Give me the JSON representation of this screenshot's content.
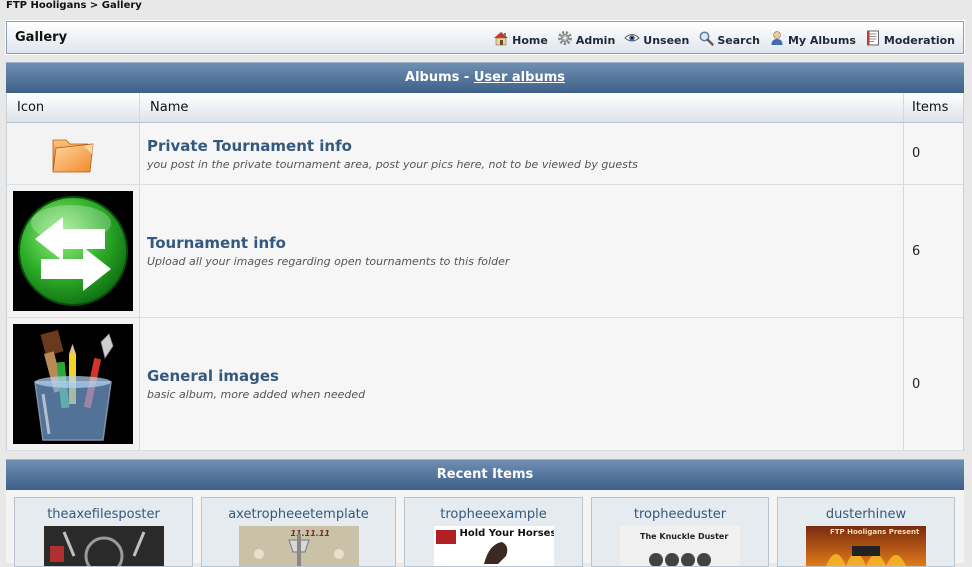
{
  "breadcrumb": {
    "root": "FTP Hooligans",
    "sep": ">",
    "current": "Gallery"
  },
  "topbar": {
    "title": "Gallery",
    "nav": [
      {
        "label": "Home",
        "icon": "home-icon"
      },
      {
        "label": "Admin",
        "icon": "gear-icon"
      },
      {
        "label": "Unseen",
        "icon": "eye-icon"
      },
      {
        "label": "Search",
        "icon": "search-icon"
      },
      {
        "label": "My Albums",
        "icon": "user-icon"
      },
      {
        "label": "Moderation",
        "icon": "document-icon"
      }
    ]
  },
  "albums": {
    "header": "Albums",
    "header_sep": "-",
    "header_link": "User albums",
    "columns": {
      "icon": "Icon",
      "name": "Name",
      "items": "Items"
    },
    "rows": [
      {
        "title": "Private Tournament info",
        "desc": "you post in the private tournament area, post your pics here, not to be viewed by guests",
        "items": "0",
        "icon": "folder-icon"
      },
      {
        "title": "Tournament info",
        "desc": "Upload all your images regarding open tournaments to this folder",
        "items": "6",
        "icon": "exchange-arrows-icon"
      },
      {
        "title": "General images",
        "desc": "basic album, more added when needed",
        "items": "0",
        "icon": "pencil-cup-icon"
      }
    ]
  },
  "recent": {
    "header": "Recent Items",
    "items": [
      {
        "name": "theaxefilesposter"
      },
      {
        "name": "axetropheeetemplate",
        "art_text": "11.11.11"
      },
      {
        "name": "tropheeexample",
        "art_text": "Hold Your Horses"
      },
      {
        "name": "tropheeduster",
        "art_text": "The Knuckle Duster"
      },
      {
        "name": "dusterhinew",
        "art_text": "FTP Hooligans Present"
      }
    ]
  },
  "colors": {
    "header_blue": "#3e6088",
    "link_blue": "#34597e"
  }
}
